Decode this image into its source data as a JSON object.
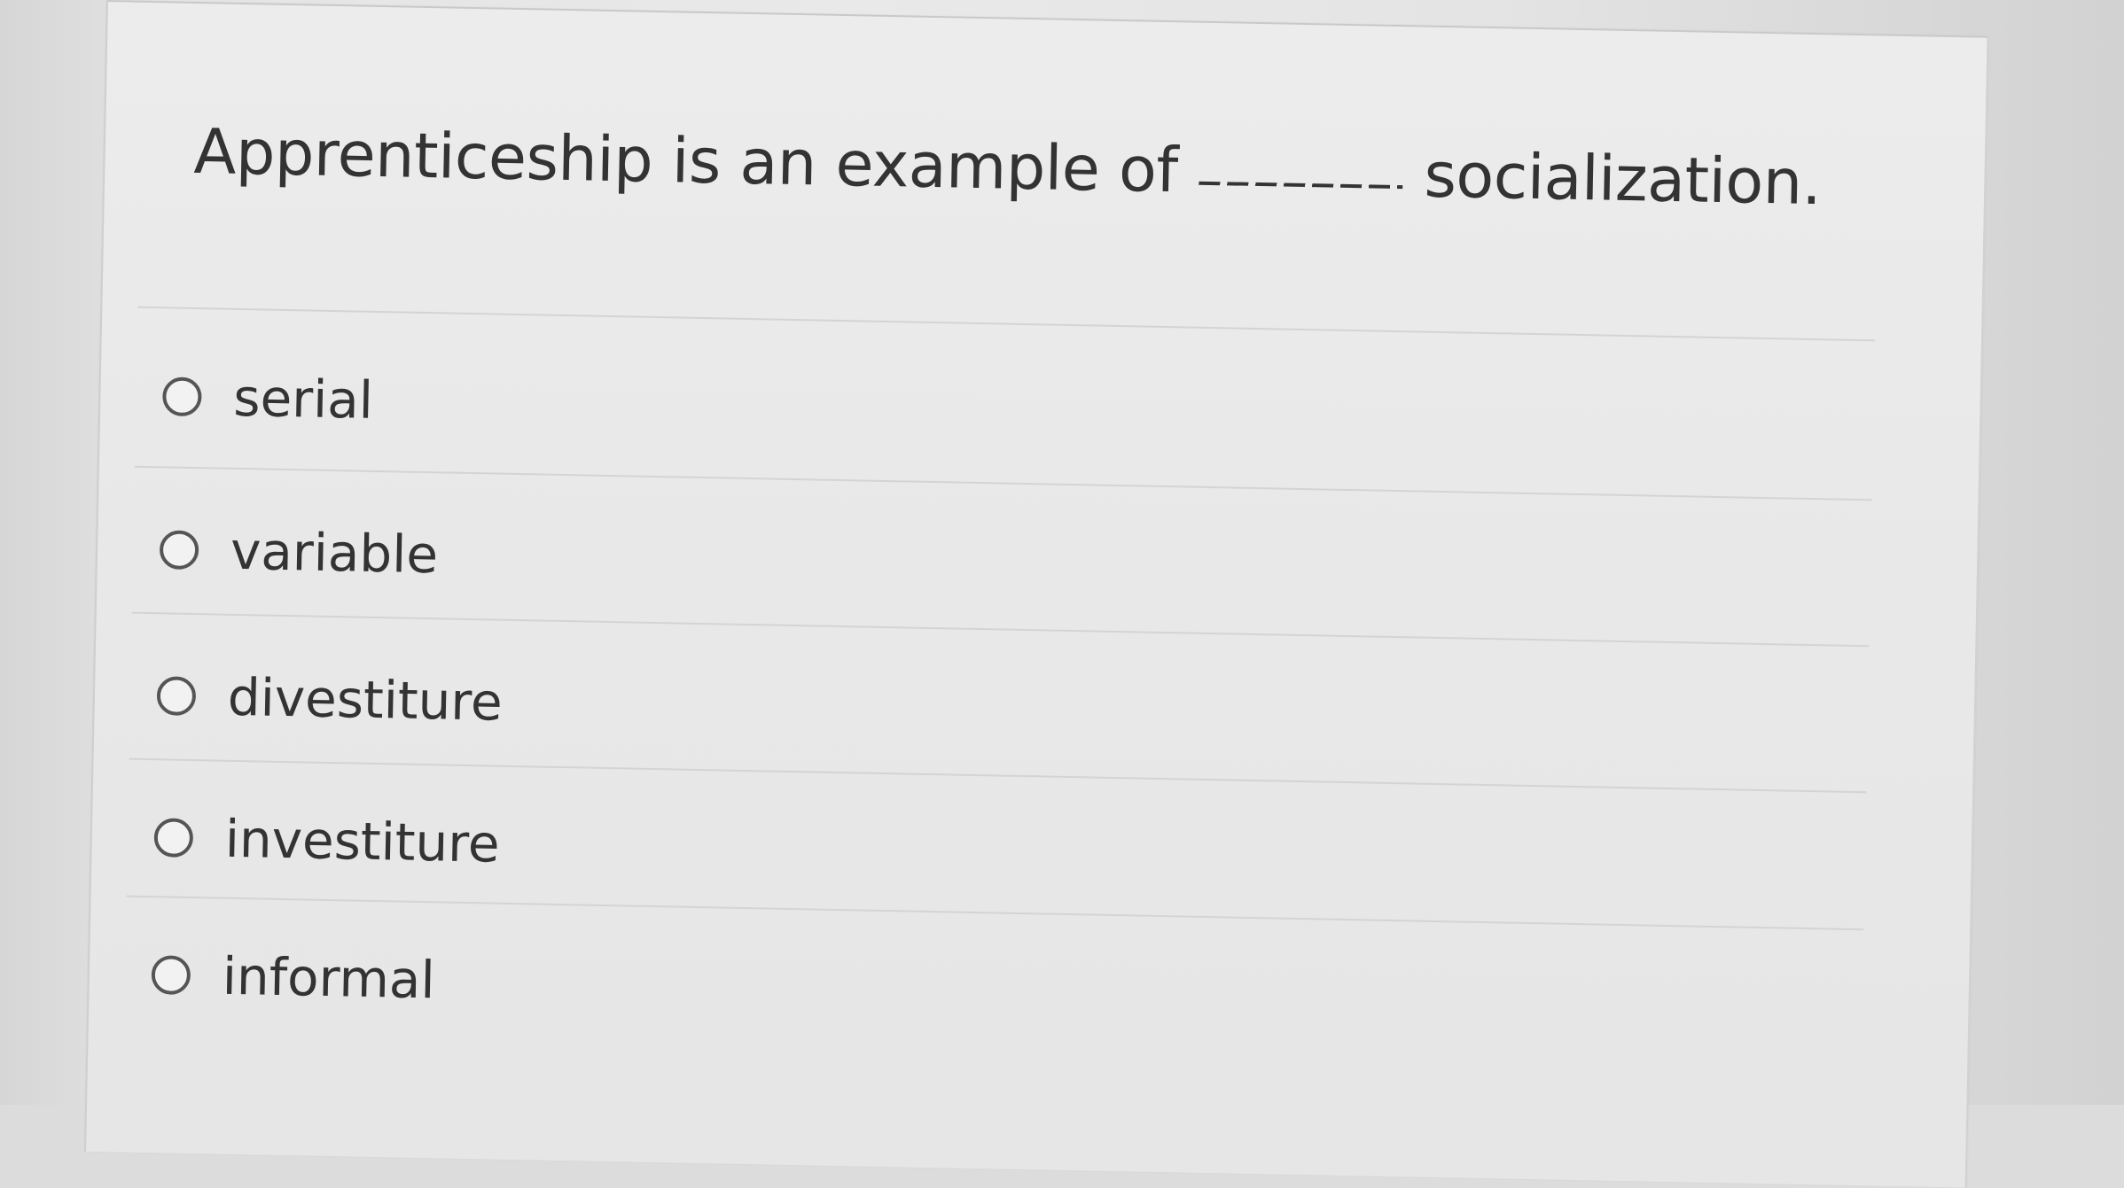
{
  "question": {
    "before_blank": "Apprenticeship is an example of",
    "after_blank": "socialization."
  },
  "options": [
    {
      "label": "serial",
      "selected": false
    },
    {
      "label": "variable",
      "selected": false
    },
    {
      "label": "divestiture",
      "selected": false
    },
    {
      "label": "investiture",
      "selected": false
    },
    {
      "label": "informal",
      "selected": false
    }
  ]
}
